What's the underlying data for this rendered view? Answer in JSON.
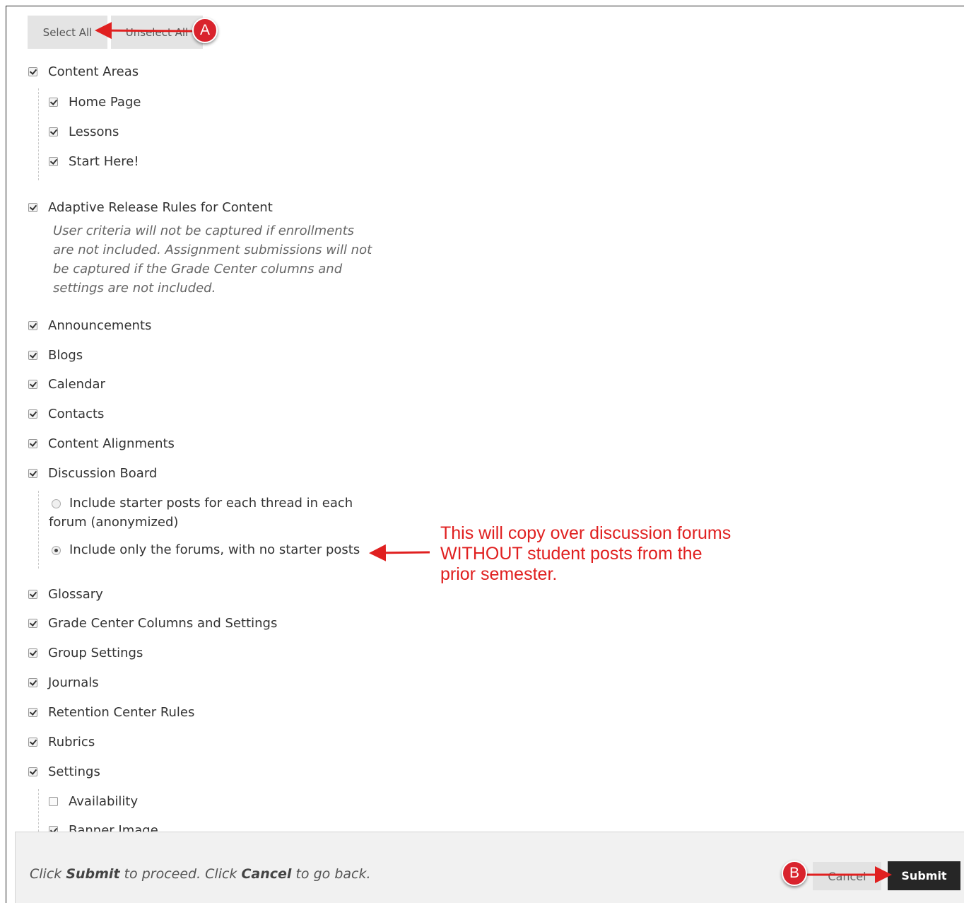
{
  "toolbar": {
    "select_all": "Select All",
    "unselect_all": "Unselect All"
  },
  "items": {
    "content_areas": "Content Areas",
    "home_page": "Home Page",
    "lessons": "Lessons",
    "start_here": "Start Here!",
    "adaptive_release": "Adaptive Release Rules for Content",
    "adaptive_note": "User criteria will not be captured if enrollments are not included. Assignment submissions will not be captured if the Grade Center columns and settings are not included.",
    "announcements": "Announcements",
    "blogs": "Blogs",
    "calendar": "Calendar",
    "contacts": "Contacts",
    "content_alignments": "Content Alignments",
    "discussion_board": "Discussion Board",
    "radio_starter": "Include starter posts for each thread in each forum (anonymized)",
    "radio_forums_only": "Include only the forums, with no starter posts",
    "glossary": "Glossary",
    "grade_center": "Grade Center Columns and Settings",
    "group_settings": "Group Settings",
    "journals": "Journals",
    "retention_center": "Retention Center Rules",
    "rubrics": "Rubrics",
    "settings": "Settings",
    "availability": "Availability",
    "banner_image": "Banner Image"
  },
  "annotation": {
    "text": "This will copy over discussion forums WITHOUT student posts from the prior semester.",
    "marker_a": "A",
    "marker_b": "B",
    "color": "#e02020"
  },
  "footer": {
    "pre1": "Click ",
    "submit_word": "Submit",
    "mid": " to proceed. Click ",
    "cancel_word": "Cancel",
    "post": " to go back.",
    "cancel_label": "Cancel",
    "submit_label": "Submit"
  }
}
